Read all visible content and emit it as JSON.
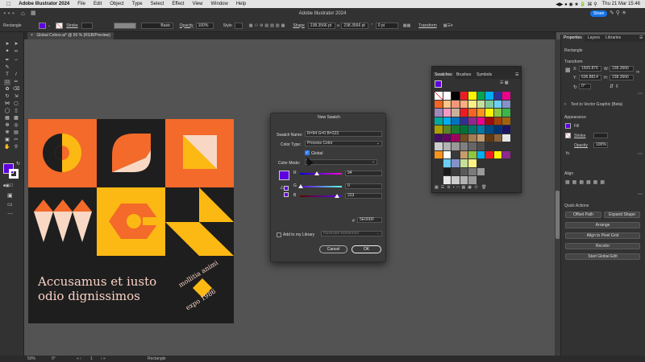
{
  "menubar": {
    "app_name": "Adobe Illustrator 2024",
    "items": [
      "File",
      "Edit",
      "Object",
      "Type",
      "Select",
      "Effect",
      "View",
      "Window",
      "Help"
    ],
    "clock": "Thu 21 Mar 15:46"
  },
  "titlebar": {
    "title": "Adobe Illustrator 2024",
    "share_label": "Share"
  },
  "controlbar": {
    "object_type": "Rectangle",
    "stroke_label": "Stroke",
    "basic_label": "Basic",
    "opacity_label": "Opacity",
    "opacity_value": "100%",
    "style_label": "Style",
    "shape_label": "Shape",
    "width_value": "238.3566 pt",
    "height_value": "238.3566 pt",
    "corner_value": "0 pt",
    "transform_label": "Transform"
  },
  "document": {
    "tab_label": "Global Colors.ai* @ 50 % (RGB/Preview)"
  },
  "artwork": {
    "headline_line1": "Accusamus et iusto",
    "headline_line2": "odio dignissimos",
    "badge_top": "mollitia animi",
    "badge_bottom": "expo 1986"
  },
  "swatches_panel": {
    "tabs": [
      "Swatches",
      "Brushes",
      "Symbols"
    ],
    "colors": [
      "#ffffff",
      "#000000",
      "#ee1c25",
      "#fff200",
      "#00a651",
      "#00aeef",
      "#2e3192",
      "#ec008c",
      "#f26522",
      "#fdc689",
      "#f7977a",
      "#f9ad81",
      "#fbf185",
      "#c4df9b",
      "#82ca9c",
      "#6dcff6",
      "#8393ca",
      "#a186be",
      "#f49ac1",
      "#c7b299",
      "#ed1c24",
      "#f26522",
      "#f7941d",
      "#fff200",
      "#8dc63f",
      "#39b54a",
      "#00a99d",
      "#00aeef",
      "#0072bc",
      "#2e3192",
      "#92278f",
      "#ec008c",
      "#9e0b0f",
      "#a0410d",
      "#a3620a",
      "#aba000",
      "#598527",
      "#197b30",
      "#007236",
      "#00746b",
      "#0076a3",
      "#004a80",
      "#003471",
      "#1b1464",
      "#440e62",
      "#630460",
      "#9e005d",
      "#754c24",
      "#a67c52",
      "#c69c6d",
      "#603913",
      "#8c6239",
      "#e6e6e6",
      "#cccccc",
      "#b3b3b3",
      "#999999",
      "#808080",
      "#666666",
      "#4d4d4d",
      "#333333"
    ],
    "gradient_row_colors": [
      "#f7941d",
      "#ffffff",
      "#3a3a3a",
      "#c69c6d",
      "#8dc63f",
      "#00aeef",
      "#ed1c24",
      "#fff200",
      "#92278f",
      "#000000"
    ],
    "group_colors_a": [
      "#6dcff6",
      "#8393ca",
      "#c4df9b",
      "#fbf185"
    ],
    "group_colors_b": [
      "#1a1a1a",
      "#3a3a3a",
      "#5a5a5a",
      "#7a7a7a",
      "#9a9a9a"
    ],
    "group_colors_c": [
      "#e6e6e6",
      "#cccccc",
      "#b3b3b3",
      "#999999"
    ]
  },
  "new_swatch_dialog": {
    "title": "New Swatch",
    "swatch_name_label": "Swatch Name:",
    "swatch_name_value": "R=94 G=0 B=223",
    "color_type_label": "Color Type:",
    "color_type_value": "Process Color",
    "global_label": "Global",
    "color_mode_label": "Color Mode:",
    "r_label": "R",
    "r_value": "94",
    "g_label": "G",
    "g_value": "0",
    "b_label": "B",
    "b_value": "223",
    "hex_label": "#",
    "hex_value": "5E00DF",
    "library_label": "Add to my Library",
    "library_placeholder": "Illustrator Advanced",
    "cancel_label": "Cancel",
    "ok_label": "OK",
    "swatch_color": "#5e00df"
  },
  "properties_panel": {
    "tabs": [
      "Properties",
      "Layers",
      "Libraries"
    ],
    "object_label": "Rectangle",
    "transform_heading": "Transform",
    "x_label": "X:",
    "x_value": "1505.876",
    "y_label": "Y:",
    "y_value": "636.8814",
    "w_label": "W:",
    "w_value": "238.3566",
    "h_label": "H:",
    "h_value": "238.3566",
    "angle_value": "0°",
    "text_vector_label": "Text to Vector Graphic (Beta)",
    "appearance_heading": "Appearance",
    "fill_label": "Fill",
    "stroke_label": "Stroke",
    "opacity_label": "Opacity",
    "opacity_value": "100%",
    "fx_label": "fx.",
    "align_heading": "Align",
    "quick_actions_heading": "Quick Actions",
    "offset_path": "Offset Path",
    "expand_shape": "Expand Shape",
    "arrange": "Arrange",
    "align_pixel_grid": "Align to Pixel Grid",
    "recolor": "Recolor",
    "start_global_edit": "Start Global Edit"
  },
  "statusbar": {
    "zoom": "50%",
    "angle": "0°",
    "page": "1",
    "tool": "Rectangle"
  },
  "colors": {
    "accent": "#5e00df",
    "orange": "#f36a2a",
    "yellow": "#fdb913",
    "peach": "#f8d8c4",
    "dark": "#1e1e1e",
    "panel": "#323232",
    "pink_light": "#fbd3c7"
  }
}
